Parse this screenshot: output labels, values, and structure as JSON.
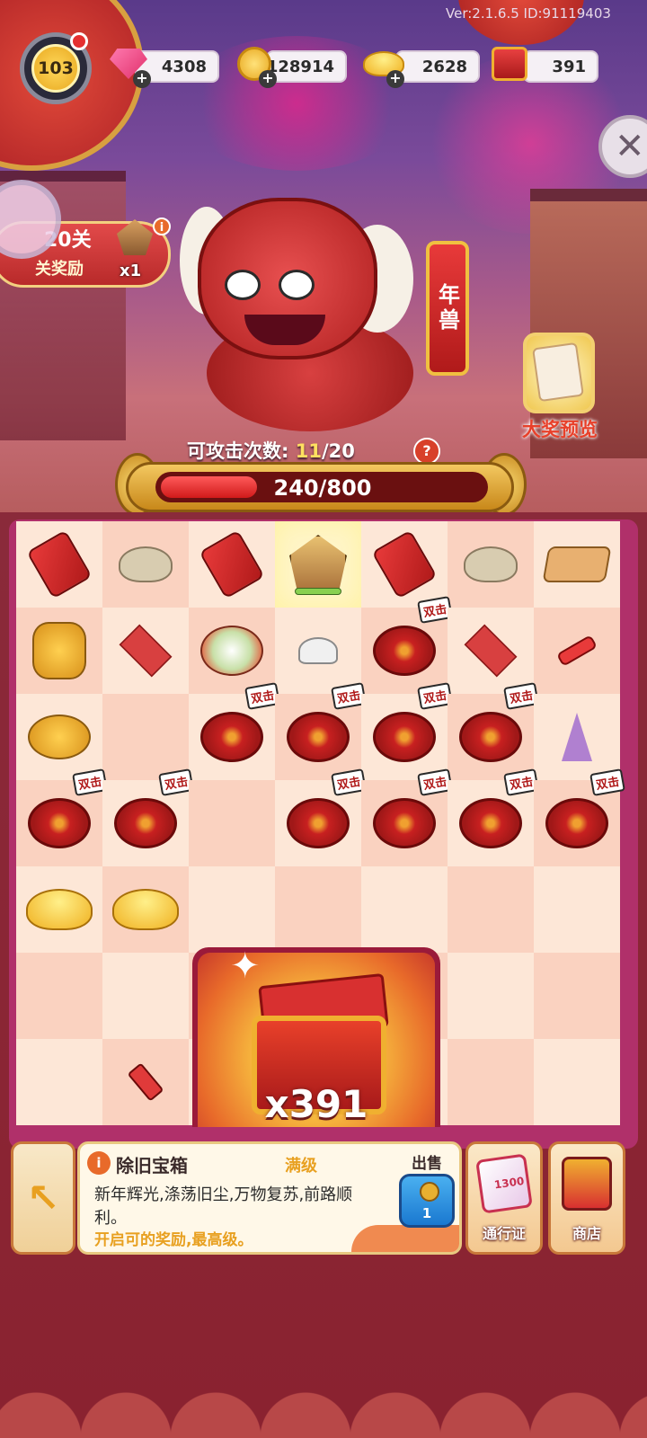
{
  "header": {
    "version": "Ver:2.1.6.5 ID:91119403",
    "player_level": "103"
  },
  "resources": [
    {
      "name": "gems",
      "icon": "gem-icon",
      "value": "4308"
    },
    {
      "name": "coins",
      "icon": "coin-icon",
      "value": "128914"
    },
    {
      "name": "gold_ingots",
      "icon": "gold-ingot-icon",
      "value": "2628"
    },
    {
      "name": "chests",
      "icon": "chest-icon",
      "value": "391"
    }
  ],
  "level_reward": {
    "level_text": "20关",
    "label": "关奖励",
    "quantity": "x1",
    "info": "i"
  },
  "boss": {
    "name": "年兽",
    "attack_label": "可攻击次数:",
    "attacks_current": "11",
    "attacks_total": "/20",
    "help": "?",
    "hp_text": "240/800",
    "hp_fraction": 0.3
  },
  "prize_preview": {
    "label": "大奖预览"
  },
  "board": {
    "double_tag": "双击",
    "cells": [
      [
        "ribbon",
        "web",
        "ribbon",
        "sign",
        "ribbon",
        "web",
        "tray"
      ],
      [
        "coins",
        "mat",
        "plate",
        "dumpling",
        "fire2",
        "mat",
        "stick"
      ],
      [
        "coins_s",
        "",
        "fire2",
        "fire2",
        "fire2",
        "fire2",
        "hat"
      ],
      [
        "fire2",
        "fire2",
        "",
        "fire2",
        "fire2",
        "fire2",
        "fire2"
      ],
      [
        "ingots",
        "ingots",
        "",
        "",
        "",
        "",
        ""
      ],
      [
        "",
        "",
        "",
        "",
        "",
        "",
        ""
      ],
      [
        "",
        "cracker",
        "",
        "",
        "",
        "",
        ""
      ]
    ]
  },
  "chest": {
    "count": "x391"
  },
  "info_panel": {
    "info": "i",
    "title": "除旧宝箱",
    "level": "满级",
    "description": "新年辉光,涤荡旧尘,万物复苏,前路顺利。",
    "hint": "开启可的奖励,最高级。",
    "sell_label": "出售",
    "sell_value": "1"
  },
  "side_buttons": {
    "pass_label": "通行证",
    "pass_badge": "1300",
    "shop_label": "商店"
  }
}
